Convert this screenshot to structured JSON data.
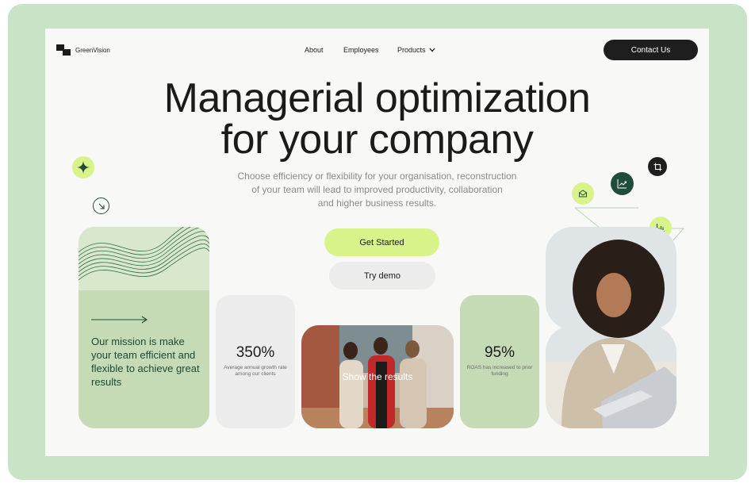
{
  "header": {
    "brand": "GreenVision",
    "nav": [
      "About",
      "Employees",
      "Products"
    ],
    "contact_label": "Contact Us"
  },
  "hero": {
    "title_line1": "Managerial optimization",
    "title_line2": "for your company",
    "subtitle_line1": "Choose efficiency or flexibility for your organisation, reconstruction",
    "subtitle_line2": "of your team will lead to improved productivity, collaboration",
    "subtitle_line3": "and higher business results.",
    "primary_cta": "Get Started",
    "secondary_cta": "Try demo"
  },
  "cards": {
    "mission": "Our mission is make your team efficient and flexible to achieve great results",
    "stat1_value": "350%",
    "stat1_desc": "Average annual growth rate among our clients",
    "stat2_value": "95%",
    "stat2_desc": "ROAS has increased to prior funding",
    "team_caption": "Show the results"
  },
  "colors": {
    "frame": "#c9e3c7",
    "accent_lime": "#d8f38a",
    "sage": "#c5dbb6",
    "dark": "#1e1e1e",
    "deep_green": "#1f4d3a"
  },
  "icons": [
    "sparkle-icon",
    "arrow-down-right-icon",
    "mail-icon",
    "chart-line-icon",
    "crop-icon",
    "bar-chart-icon",
    "chevron-down-icon",
    "arrow-right-icon"
  ]
}
